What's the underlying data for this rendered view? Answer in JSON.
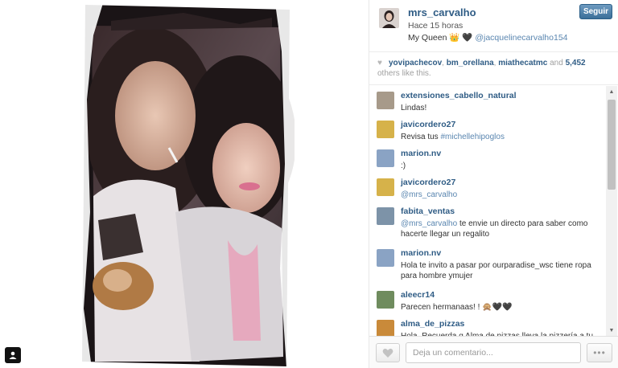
{
  "post": {
    "username": "mrs_carvalho",
    "time": "Hace 15 horas",
    "caption_text": "My Queen 👑 🖤 ",
    "caption_mention": "@jacquelinecarvalho154",
    "follow_label": "Seguir"
  },
  "likes": {
    "likers": [
      "yovipachecov",
      "bm_orellana",
      "miathecatmc"
    ],
    "sep1": ", ",
    "sep2": ", ",
    "and_text": " and ",
    "count": "5,452",
    "others_text": "others like this."
  },
  "comments": [
    {
      "user": "extensiones_cabello_natural",
      "text": "Lindas!",
      "mention": "",
      "after": "",
      "avatar": "#a79a8a"
    },
    {
      "user": "javicordero27",
      "text": "Revisa tus ",
      "mention": "#michellehipoglos",
      "after": "",
      "avatar": "#d6b24a"
    },
    {
      "user": "marion.nv",
      "text": ":)",
      "mention": "",
      "after": "",
      "avatar": "#8aa3c4"
    },
    {
      "user": "javicordero27",
      "text": "",
      "mention": "@mrs_carvalho",
      "after": "",
      "avatar": "#d6b24a"
    },
    {
      "user": "fabita_ventas",
      "text": "",
      "mention": "@mrs_carvalho",
      "after": " te envie un directo para saber como hacerte llegar un regalito",
      "avatar": "#7d93a8"
    },
    {
      "user": "marion.nv",
      "text": "Hola te invito a pasar por ourparadise_wsc tiene ropa para hombre ymujer",
      "mention": "",
      "after": "",
      "avatar": "#8aa3c4"
    },
    {
      "user": "aleecr14",
      "text": "Parecen hermanaas! ! 🙊🖤🖤",
      "mention": "",
      "after": "",
      "avatar": "#6f8c5e"
    },
    {
      "user": "alma_de_pizzas",
      "text": "Hola. Recuerda q Alma de pizzas lleva la pizzería a tu",
      "mention": "",
      "after": "",
      "avatar": "#c98a3a"
    }
  ],
  "compose": {
    "placeholder": "Deja un comentario...",
    "more_label": "•••"
  },
  "icons": {
    "like": "heart-icon",
    "more": "ellipsis-icon",
    "profile": "person-icon",
    "scroll_up": "triangle-up-icon",
    "scroll_down": "triangle-down-icon"
  },
  "colors": {
    "username": "#2f5c85",
    "mention": "#5a86b0",
    "follow_button": "#3b6f99"
  }
}
